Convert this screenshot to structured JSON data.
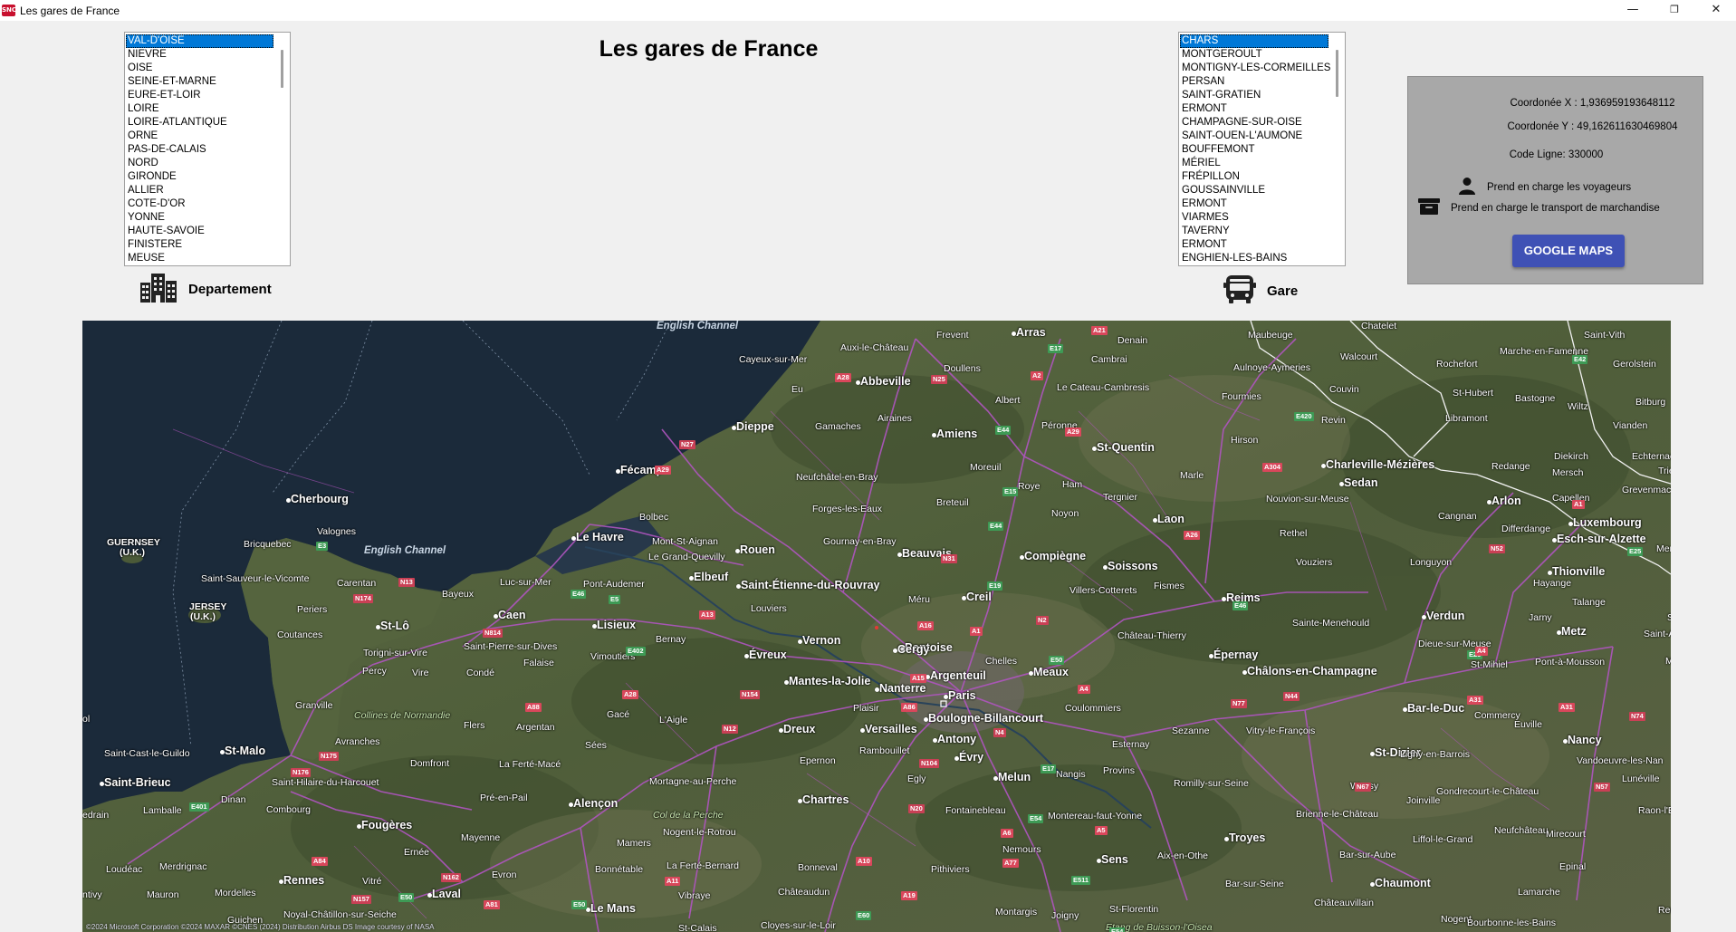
{
  "window": {
    "title": "Les gares de France",
    "app_icon_text": "SNCF",
    "minimize_glyph": "—",
    "maximize_glyph": "❐",
    "close_glyph": "✕"
  },
  "page_title": "Les gares de France",
  "departement": {
    "label": "Departement",
    "icon": "buildings-icon",
    "items": [
      "VAL-D'OISE",
      "NIEVRE",
      "OISE",
      "SEINE-ET-MARNE",
      "EURE-ET-LOIR",
      "LOIRE",
      "LOIRE-ATLANTIQUE",
      "ORNE",
      "PAS-DE-CALAIS",
      "NORD",
      "GIRONDE",
      "ALLIER",
      "COTE-D'OR",
      "YONNE",
      "HAUTE-SAVOIE",
      "FINISTERE",
      "MEUSE"
    ],
    "selected_index": 0
  },
  "gare": {
    "label": "Gare",
    "icon": "bus-icon",
    "items": [
      "CHARS",
      "MONTGEROULT",
      "MONTIGNY-LES-CORMEILLES",
      "PERSAN",
      "SAINT-GRATIEN",
      "ERMONT",
      "CHAMPAGNE-SUR-OISE",
      "SAINT-OUEN-L'AUMONE",
      "BOUFFEMONT",
      "MÉRIEL",
      "FRÉPILLON",
      "GOUSSAINVILLE",
      "ERMONT",
      "VIARMES",
      "TAVERNY",
      "ERMONT",
      "ENGHIEN-LES-BAINS"
    ],
    "selected_index": 0
  },
  "info": {
    "coord_x": "Coordonée X : 1,936959193648112",
    "coord_y": "Coordonée Y : 49,162611630469804",
    "code_ligne": "Code Ligne: 330000",
    "voyageurs": "Prend en charge les voyageurs",
    "marchandise": "Prend en charge le transport de marchandise",
    "google_maps_button": "GOOGLE MAPS",
    "panel_color": "#a8a8a8",
    "button_color": "#3f51b5"
  },
  "map": {
    "credit": "©2024 Microsoft Corporation ©2024 MAXAR ©CNES (2024) Distribution Airbus DS Image courtesy of NASA",
    "seas": {
      "english_channel_top": "English Channel",
      "english_channel_mid": "English Channel"
    },
    "islands": {
      "guernsey": "GUERNSEY",
      "guernsey_uk": "(U.K.)",
      "jersey": "JERSEY",
      "jersey_uk": "(U.K.)"
    },
    "regions": {
      "collines": "Collines de Normandie",
      "col_perche": "Col de la Perche",
      "etang": "Etang de Buisson-l'Oisea"
    },
    "cities_big": {
      "paris": "Paris",
      "rouen": "Rouen",
      "amiens": "Amiens",
      "caen": "Caen",
      "le_havre": "Le Havre",
      "reims": "Reims",
      "rennes": "Rennes",
      "le_mans": "Le Mans",
      "cherbourg": "Cherbourg",
      "dieppe": "Dieppe",
      "saint_malo": "St-Malo",
      "luxembourg": "Luxembourg",
      "metz": "Metz",
      "nancy": "Nancy",
      "troyes": "Troyes",
      "orleans_chartres": "Chartres",
      "beauvais": "Beauvais",
      "compiegne": "Compiègne",
      "saint_quentin": "St-Quentin",
      "arras": "Arras",
      "abbeville": "Abbeville",
      "chalons": "Châlons-en-Champagne",
      "boulogne": "Boulogne-Billancourt",
      "versailles": "Versailles",
      "argenteuil": "Argenteuil",
      "alencon": "Alençon",
      "laval": "Laval",
      "evreux": "Évreux",
      "lisieux": "Lisieux",
      "fecamp": "Fécamp",
      "sedan": "Sedan",
      "charleville": "Charleville-Mézières",
      "thionville": "Thionville",
      "saint_dizier": "St-Dizier",
      "chaumont": "Chaumont",
      "epernay": "Épernay",
      "soissons": "Soissons",
      "laon": "Laon",
      "creil": "Creil",
      "meaux": "Meaux",
      "melun": "Melun",
      "nanterre": "Nanterre",
      "dreux": "Dreux",
      "vernon": "Vernon",
      "pontoise": "Pontoise",
      "cergy": "Cergy",
      "antony": "Antony",
      "evry": "Évry",
      "mantes": "Mantes-la-Jolie",
      "elbeuf": "Elbeuf",
      "sotteville": "Saint-Étienne-du-Rouvray",
      "bar_le_duc": "Bar-le-Duc",
      "verdun": "Verdun",
      "sens": "Sens",
      "fougeres": "Fougères",
      "saint_lo": "St-Lô",
      "saint_brieuc": "Saint-Brieuc",
      "arlon": "Arlon",
      "esch": "Esch-sur-Alzette"
    },
    "cities_small": {
      "frevent": "Frevent",
      "denain": "Denain",
      "maubeuge": "Maubeuge",
      "chatelet": "Chatelet",
      "saint_vith": "Saint-Vith",
      "doullens": "Doullens",
      "cambrai": "Cambrai",
      "aulnoye": "Aulnoye-Aymeries",
      "walcourt": "Walcourt",
      "marche": "Marche-en-Famenne",
      "gerolstein": "Gerolstein",
      "cayeux": "Cayeux-sur-Mer",
      "auxi": "Auxi-le-Château",
      "le_cateau": "Le Cateau-Cambresis",
      "rochefort": "Rochefort",
      "eu": "Eu",
      "albert": "Albert",
      "fourmies": "Fourmies",
      "couvin": "Couvin",
      "st_hubert": "St-Hubert",
      "bastogne": "Bastogne",
      "wiltz": "Wiltz",
      "bitburg": "Bitburg",
      "gamaches": "Gamaches",
      "airaines": "Airaines",
      "peronne": "Péronne",
      "revin": "Revin",
      "libramont": "Libramont",
      "vianden": "Vianden",
      "hirson": "Hirson",
      "diekirch": "Diekirch",
      "echternach": "Echternach",
      "moreuil": "Moreuil",
      "neufchatel": "Neufchâtel-en-Bray",
      "roye": "Roye",
      "ham": "Ham",
      "marle": "Marle",
      "redange": "Redange",
      "mersch": "Mersch",
      "trier": "Trier",
      "tergnier": "Tergnier",
      "nouvion": "Nouvion-sur-Meuse",
      "grevenmacher": "Grevenmacher",
      "bolbec": "Bolbec",
      "forges": "Forges-les-Eaux",
      "breteuil": "Breteuil",
      "noyon": "Noyon",
      "capellen": "Capellen",
      "cangnan": "Cangnan",
      "valognes": "Valognes",
      "bricquebec": "Bricquebec",
      "mont_st_aignan": "Mont-St-Aignan",
      "gournay": "Gournay-en-Bray",
      "rethel": "Rethel",
      "differdange": "Differdange",
      "grand_quevilly": "Le Grand-Quevilly",
      "vouziers": "Vouziers",
      "longuyon": "Longuyon",
      "merzig": "Mer",
      "st_sauveur": "Saint-Sauveur-le-Vicomte",
      "carentan": "Carentan",
      "luc": "Luc-sur-Mer",
      "pont_audemer": "Pont-Audemer",
      "fismes": "Fismes",
      "hayange": "Hayange",
      "bayeux": "Bayeux",
      "louviers": "Louviers",
      "meru": "Méru",
      "villers": "Villers-Cotterets",
      "talange": "Talange",
      "periers": "Periers",
      "saar": "Saar",
      "st_lo_small": "St-Lô",
      "bernay": "Bernay",
      "chateau_thierry": "Château-Thierry",
      "sainte_menehould": "Sainte-Menehould",
      "jarny": "Jarny",
      "coutances": "Coutances",
      "torigni": "Torigni-sur-Vire",
      "st_pierre": "Saint-Pierre-sur-Dives",
      "dieue": "Dieue-sur-Meuse",
      "saint_a": "Saint-A",
      "chelles": "Chelles",
      "falaise": "Falaise",
      "vimoutiers": "Vimoutiers",
      "plaisir": "Plaisir",
      "st_mihiel": "St-Mihiel",
      "pont_a_mousson": "Pont-à-Mousson",
      "mor": "Mor",
      "percy": "Percy",
      "vire": "Vire",
      "conde": "Condé",
      "coulommiers": "Coulommiers",
      "granville": "Granville",
      "gace": "Gacé",
      "laigle": "L'Aigle",
      "vitry": "Vitry-le-François",
      "sezanne": "Sezanne",
      "commercy": "Commercy",
      "euville": "Euville",
      "flers": "Flers",
      "argentan": "Argentan",
      "avranches": "Avranches",
      "sees": "Sées",
      "rambouillet": "Rambouillet",
      "epernon": "Epernon",
      "esternay": "Esternay",
      "saint_cast": "Saint-Cast-le-Guildo",
      "domfront": "Domfront",
      "la_ferte_mace": "La Ferté-Macé",
      "ligny": "Ligny-en-Barrois",
      "vandoeuvre": "Vandoeuvre-les-Nan",
      "lunevi": "Lunéville",
      "mortagne": "Mortagne-au-Perche",
      "egly": "Egly",
      "nangis": "Nangis",
      "provins": "Provins",
      "romilly": "Romilly-sur-Seine",
      "wassy": "Wassy",
      "gondrecourt": "Gondrecourt-le-Château",
      "st_hilaire": "Saint-Hilaire-du-Harcouet",
      "dinan": "Dinan",
      "pre_en_pail": "Pré-en-Pail",
      "joinville": "Joinville",
      "lamballe": "Lamballe",
      "combourg": "Combourg",
      "fontainebleau": "Fontainebleau",
      "montereau": "Montereau-faut-Yonne",
      "brienne": "Brienne-le-Château",
      "raon": "Raon-l'E",
      "edrain": "edrain",
      "neufchateau": "Neufchâteau",
      "nogent": "Nogent-le-Rotrou",
      "mamers": "Mamers",
      "nemours": "Nemours",
      "liffol": "Liffol-le-Grand",
      "mirecourt": "Mirecourt",
      "ernee": "Ernée",
      "mayenne": "Mayenne",
      "aix": "Aix-en-Othe",
      "bar_sur_aube": "Bar-sur-Aube",
      "loudeac": "Loudéac",
      "merdrignac": "Merdrignac",
      "la_ferte_bernard": "La Ferté-Bernard",
      "bonneval": "Bonneval",
      "pithiviers": "Pithiviers",
      "epinal": "Epinal",
      "evron": "Evron",
      "bonnetable": "Bonnétable",
      "vitre": "Vitré",
      "bar_sur_seine": "Bar-sur-Seine",
      "mauron": "Mauron",
      "mordelles": "Mordelles",
      "vibraye": "Vibraye",
      "chateaudun": "Châteaudun",
      "lamarche": "Lamarche",
      "pontivy": "ntivy",
      "st_florentin": "St-Florentin",
      "chateauvillain": "Châteauvillain",
      "montargis": "Montargis",
      "joigny": "Joigny",
      "nogent2": "Nogent",
      "remire": "Remire",
      "guichen": "Guichen",
      "noyal": "Noyal-Châtillon-sur-Seiche",
      "st_calais": "St-Calais",
      "cloyes": "Cloyes-sur-le-Loir",
      "bourbonne": "Bourbonne-les-Bains",
      "sol": "ol"
    },
    "shields": [
      "A21",
      "E17",
      "A28",
      "N25",
      "A2",
      "E44",
      "A29",
      "N27",
      "A29",
      "E15",
      "E44",
      "N31",
      "E19",
      "A26",
      "E46",
      "N13",
      "N174",
      "E3",
      "N814",
      "E46",
      "E5",
      "A13",
      "A16",
      "A1",
      "N2",
      "E50",
      "A4",
      "E402",
      "A28",
      "A88",
      "N154",
      "N12",
      "A15",
      "A86",
      "N4",
      "N77",
      "N44",
      "A31",
      "E23",
      "N52",
      "A4",
      "E25",
      "A31",
      "N175",
      "N176",
      "E401",
      "A84",
      "N157",
      "E50",
      "N162",
      "A81",
      "E50",
      "A11",
      "A10",
      "A19",
      "N104",
      "E17",
      "E54",
      "A5",
      "A6",
      "N20",
      "A77",
      "E511",
      "E54",
      "E60",
      "N67",
      "N57",
      "N74",
      "A304",
      "E420",
      "E42",
      "A1"
    ],
    "colors": {
      "land": "#4d5a3a",
      "sea": "#1b2a3a",
      "road": "#b055c0",
      "border": "#ffffff"
    }
  }
}
